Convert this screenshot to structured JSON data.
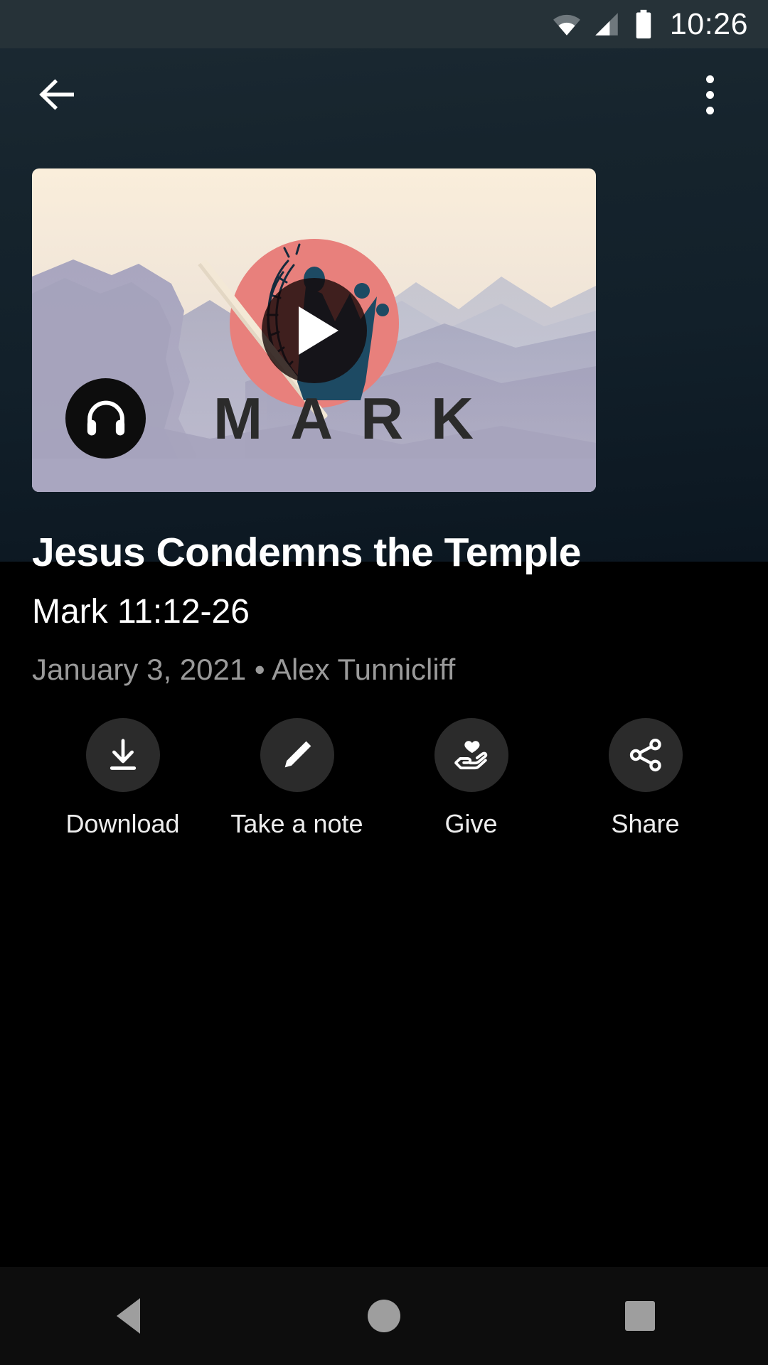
{
  "status_bar": {
    "time": "10:26",
    "icons": [
      "wifi-icon",
      "cellular-signal-icon",
      "battery-icon"
    ]
  },
  "app_bar": {
    "back_icon": "arrow-back-icon",
    "overflow_icon": "more-vertical-icon"
  },
  "media": {
    "play_icon": "play-icon",
    "headphones_icon": "headphones-icon",
    "series_word": "MARK",
    "artwork": {
      "circle_color": "#e8807c",
      "crown_color": "#1d4a63",
      "sky_color": "#f8ecd8",
      "mountain_color": "#a8a4bd"
    }
  },
  "sermon": {
    "title": "Jesus Condemns the Temple",
    "reference": "Mark 11:12-26",
    "meta": "January 3, 2021 • Alex Tunnicliff"
  },
  "actions": [
    {
      "label": "Download",
      "icon": "download-icon"
    },
    {
      "label": "Take a note",
      "icon": "pencil-icon"
    },
    {
      "label": "Give",
      "icon": "hand-heart-icon"
    },
    {
      "label": "Share",
      "icon": "share-icon"
    }
  ],
  "nav_bar": {
    "back": "nav-back-triangle-icon",
    "home": "nav-home-circle-icon",
    "recents": "nav-recents-square-icon"
  },
  "colors": {
    "status_bar_bg": "#263238",
    "page_bg": "#000000",
    "action_circle_bg": "#2b2b2b",
    "meta_text": "#9a9a9a"
  }
}
